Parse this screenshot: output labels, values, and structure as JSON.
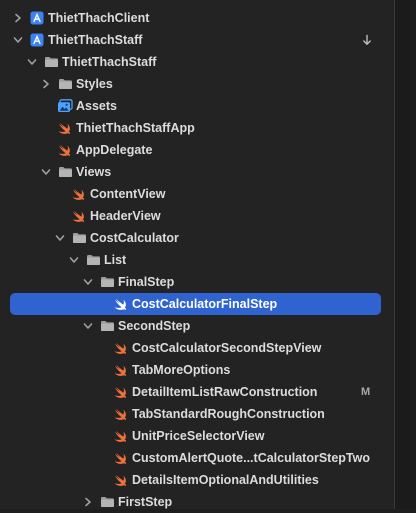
{
  "colors": {
    "background": "#232323",
    "selection": "#2f63d0",
    "folder": "#9d9d9d",
    "swift": "#f0703a",
    "project": "#3b82f6",
    "assets": "#4aa3ff"
  },
  "tree": [
    {
      "label": "ThietThachClient",
      "icon": "xcode-project-icon",
      "depth": 0,
      "chevron": "right"
    },
    {
      "label": "ThietThachStaff",
      "icon": "xcode-project-icon",
      "depth": 0,
      "chevron": "down",
      "trailing": "download-arrow-icon"
    },
    {
      "label": "ThietThachStaff",
      "icon": "folder-icon",
      "depth": 1,
      "chevron": "down"
    },
    {
      "label": "Styles",
      "icon": "folder-icon",
      "depth": 2,
      "chevron": "right"
    },
    {
      "label": "Assets",
      "icon": "asset-catalog-icon",
      "depth": 2
    },
    {
      "label": "ThietThachStaffApp",
      "icon": "swift-file-icon",
      "depth": 2
    },
    {
      "label": "AppDelegate",
      "icon": "swift-file-icon",
      "depth": 2
    },
    {
      "label": "Views",
      "icon": "folder-icon",
      "depth": 2,
      "chevron": "down"
    },
    {
      "label": "ContentView",
      "icon": "swift-file-icon",
      "depth": 3
    },
    {
      "label": "HeaderView",
      "icon": "swift-file-icon",
      "depth": 3
    },
    {
      "label": "CostCalculator",
      "icon": "folder-icon",
      "depth": 3,
      "chevron": "down"
    },
    {
      "label": "List",
      "icon": "folder-icon",
      "depth": 4,
      "chevron": "down"
    },
    {
      "label": "FinalStep",
      "icon": "folder-icon",
      "depth": 5,
      "chevron": "down"
    },
    {
      "label": "CostCalculatorFinalStep",
      "icon": "swift-file-icon",
      "depth": 6,
      "selected": true
    },
    {
      "label": "SecondStep",
      "icon": "folder-icon",
      "depth": 5,
      "chevron": "down"
    },
    {
      "label": "CostCalculatorSecondStepView",
      "icon": "swift-file-icon",
      "depth": 6
    },
    {
      "label": "TabMoreOptions",
      "icon": "swift-file-icon",
      "depth": 6
    },
    {
      "label": "DetailItemListRawConstruction",
      "icon": "swift-file-icon",
      "depth": 6,
      "badge": "M"
    },
    {
      "label": "TabStandardRoughConstruction",
      "icon": "swift-file-icon",
      "depth": 6
    },
    {
      "label": "UnitPriceSelectorView",
      "icon": "swift-file-icon",
      "depth": 6
    },
    {
      "label": "CustomAlertQuote...tCalculatorStepTwo",
      "icon": "swift-file-icon",
      "depth": 6
    },
    {
      "label": "DetailsItemOptionalAndUtilities",
      "icon": "swift-file-icon",
      "depth": 6
    },
    {
      "label": "FirstStep",
      "icon": "folder-icon",
      "depth": 5,
      "chevron": "right"
    }
  ]
}
